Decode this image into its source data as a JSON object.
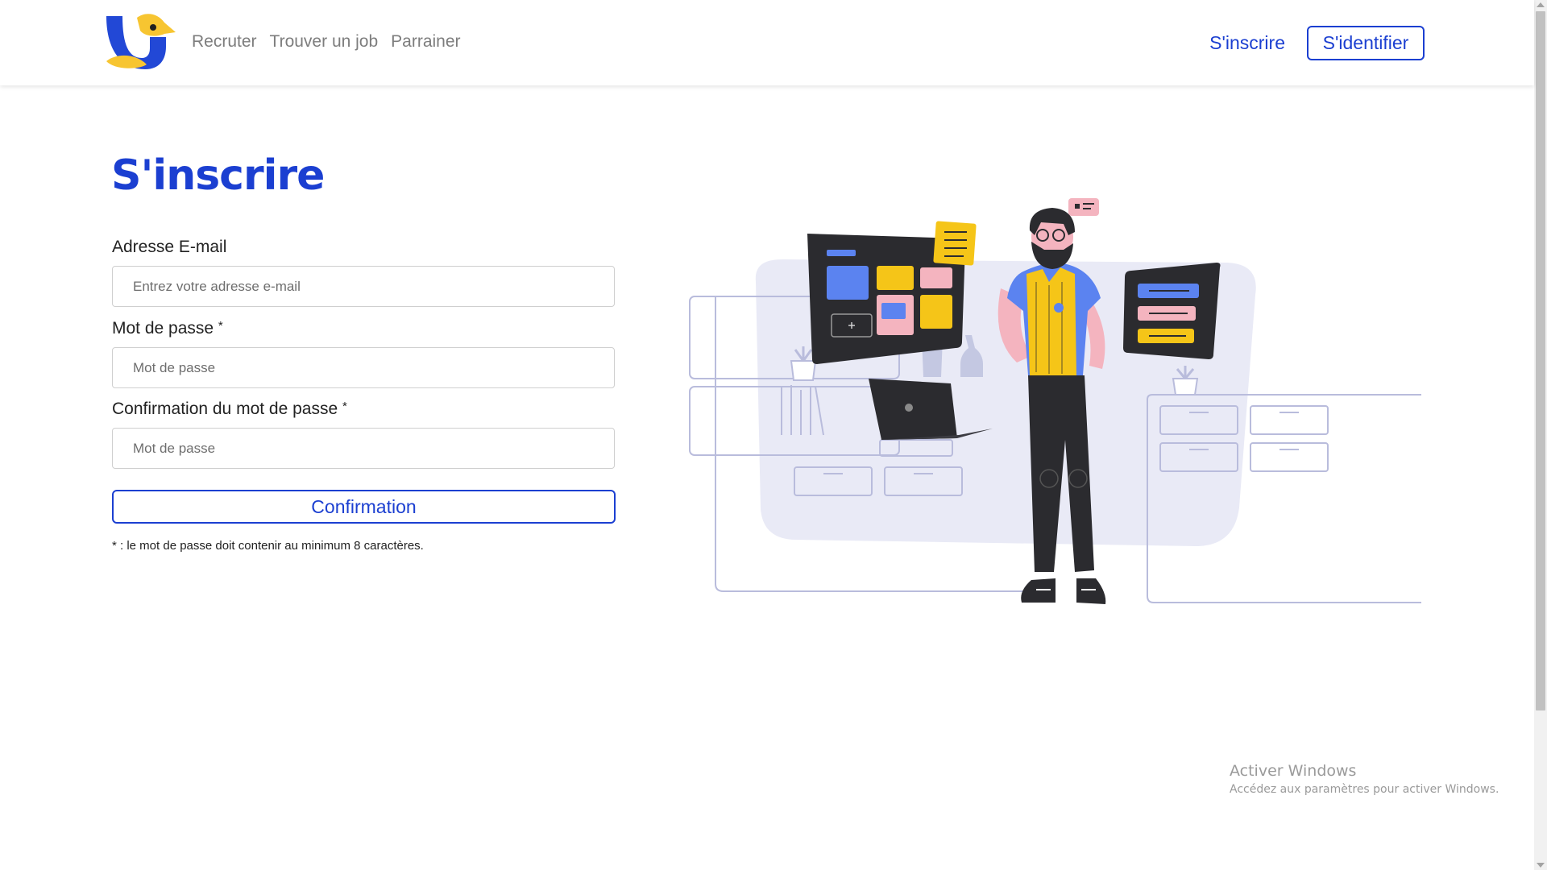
{
  "header": {
    "nav": [
      "Recruter",
      "Trouver un job",
      "Parrainer"
    ],
    "signup_label": "S'inscrire",
    "login_label": "S'identifier"
  },
  "form": {
    "title": "S'inscrire",
    "email": {
      "label": "Adresse E-mail",
      "placeholder": "Entrez votre adresse e-mail",
      "value": ""
    },
    "password": {
      "label": "Mot de passe",
      "required_mark": "*",
      "placeholder": "Mot de passe",
      "value": ""
    },
    "confirm_password": {
      "label": "Confirmation du mot de passe",
      "required_mark": "*",
      "placeholder": "Mot de passe",
      "value": ""
    },
    "submit_label": "Confirmation",
    "note": "* : le mot de passe doit contenir au minimum 8 caractères."
  },
  "watermark": {
    "title": "Activer Windows",
    "subtitle": "Accédez aux paramètres pour activer Windows."
  },
  "colors": {
    "brand_blue": "#1b3fd1",
    "logo_yellow": "#f7c531",
    "illustration_bg": "#e9eaf6",
    "accent_yellow": "#f5c518",
    "accent_blue": "#5b83f0",
    "accent_pink": "#f4b4bf",
    "dark": "#2b2b2f"
  }
}
